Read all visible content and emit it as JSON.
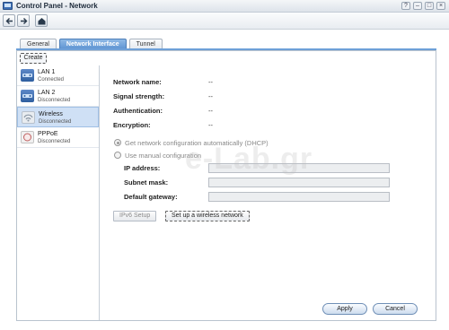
{
  "window": {
    "title": "Control Panel - Network",
    "controls": [
      "?",
      "–",
      "□",
      "×"
    ]
  },
  "tabs": [
    {
      "label": "General",
      "active": false
    },
    {
      "label": "Network Interface",
      "active": true
    },
    {
      "label": "Tunnel",
      "active": false
    }
  ],
  "toolbar": {
    "create_label": "Create"
  },
  "sidebar": {
    "items": [
      {
        "name": "LAN 1",
        "status": "Connected",
        "icon": "lan-icon",
        "selected": false
      },
      {
        "name": "LAN 2",
        "status": "Disconnected",
        "icon": "lan-icon",
        "selected": false
      },
      {
        "name": "Wireless",
        "status": "Disconnected",
        "icon": "wireless-icon",
        "selected": true
      },
      {
        "name": "PPPoE",
        "status": "Disconnected",
        "icon": "pppoe-icon",
        "selected": false
      }
    ]
  },
  "info": {
    "network_name": {
      "label": "Network name:",
      "value": "--"
    },
    "signal_strength": {
      "label": "Signal strength:",
      "value": "--"
    },
    "authentication": {
      "label": "Authentication:",
      "value": "--"
    },
    "encryption": {
      "label": "Encryption:",
      "value": "--"
    }
  },
  "config": {
    "dhcp_label": "Get network configuration automatically (DHCP)",
    "manual_label": "Use manual configuration",
    "ip_label": "IP address:",
    "subnet_label": "Subnet mask:",
    "gateway_label": "Default gateway:",
    "ip_value": "",
    "subnet_value": "",
    "gateway_value": ""
  },
  "buttons": {
    "ipv6": "IPv6 Setup",
    "wireless": "Set up a wireless network",
    "apply": "Apply",
    "cancel": "Cancel"
  },
  "watermark": "e-Lab.gr",
  "colors": {
    "accent": "#5d93d1",
    "selected_bg": "#cfe0f5"
  }
}
